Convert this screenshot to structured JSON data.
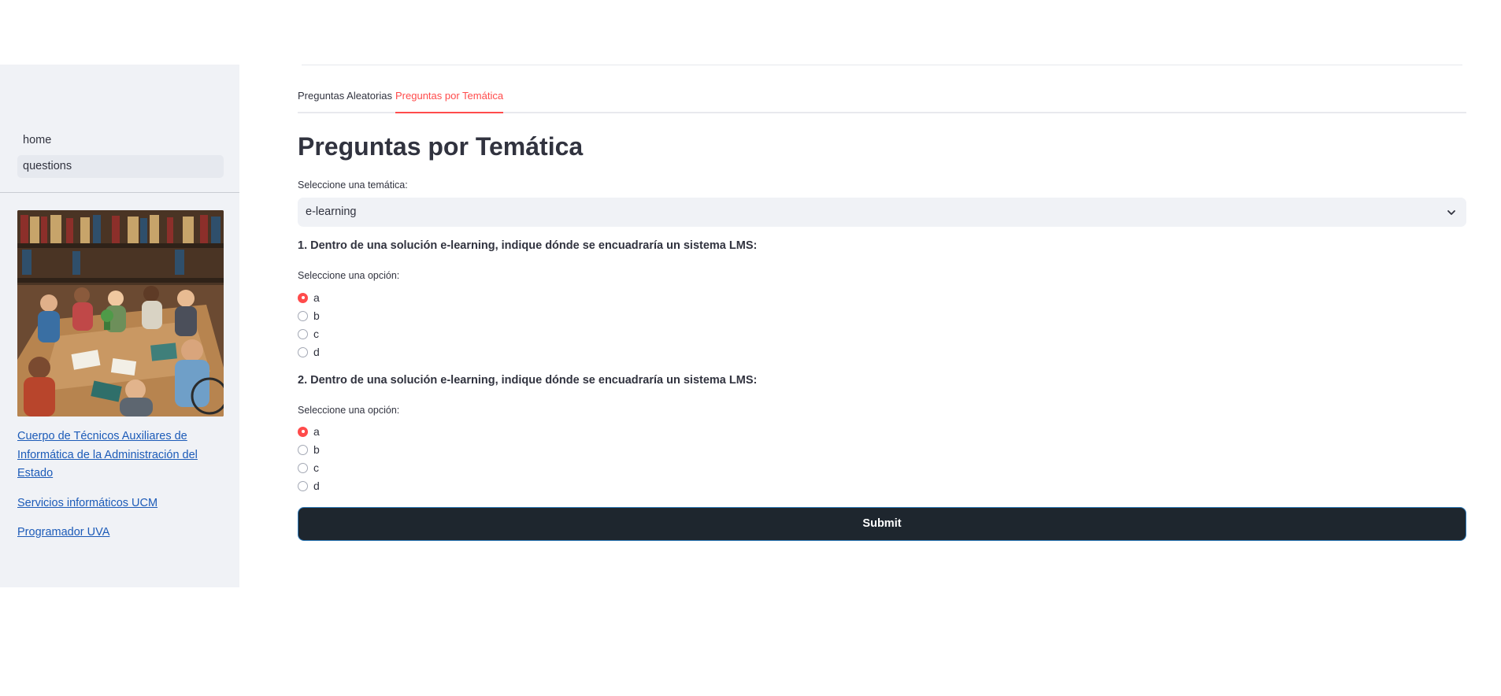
{
  "sidebar": {
    "nav": [
      {
        "label": "home",
        "active": false
      },
      {
        "label": "questions",
        "active": true
      }
    ],
    "image_alt": "People studying at library tables",
    "links": [
      {
        "label": "Cuerpo de Técnicos Auxiliares de Informática de la Administración del Estado"
      },
      {
        "label": "Servicios informáticos UCM"
      },
      {
        "label": "Programador UVA"
      }
    ]
  },
  "tabs": [
    {
      "label": "Preguntas Aleatorias",
      "active": false
    },
    {
      "label": "Preguntas por Temática",
      "active": true
    }
  ],
  "main": {
    "title": "Preguntas por Temática",
    "select_label": "Seleccione una temática:",
    "select_value": "e-learning",
    "questions": [
      {
        "text": "1. Dentro de una solución e-learning, indique dónde se encuadraría un sistema LMS:",
        "prompt": "Seleccione una opción:",
        "options": [
          "a",
          "b",
          "c",
          "d"
        ],
        "selected": "a"
      },
      {
        "text": "2. Dentro de una solución e-learning, indique dónde se encuadraría un sistema LMS:",
        "prompt": "Seleccione una opción:",
        "options": [
          "a",
          "b",
          "c",
          "d"
        ],
        "selected": "a"
      }
    ],
    "submit_label": "Submit"
  },
  "colors": {
    "accent": "#ff4b4b",
    "sidebar_bg": "#f0f2f6",
    "button_bg": "#1e262e",
    "link": "#1c5bb8"
  }
}
